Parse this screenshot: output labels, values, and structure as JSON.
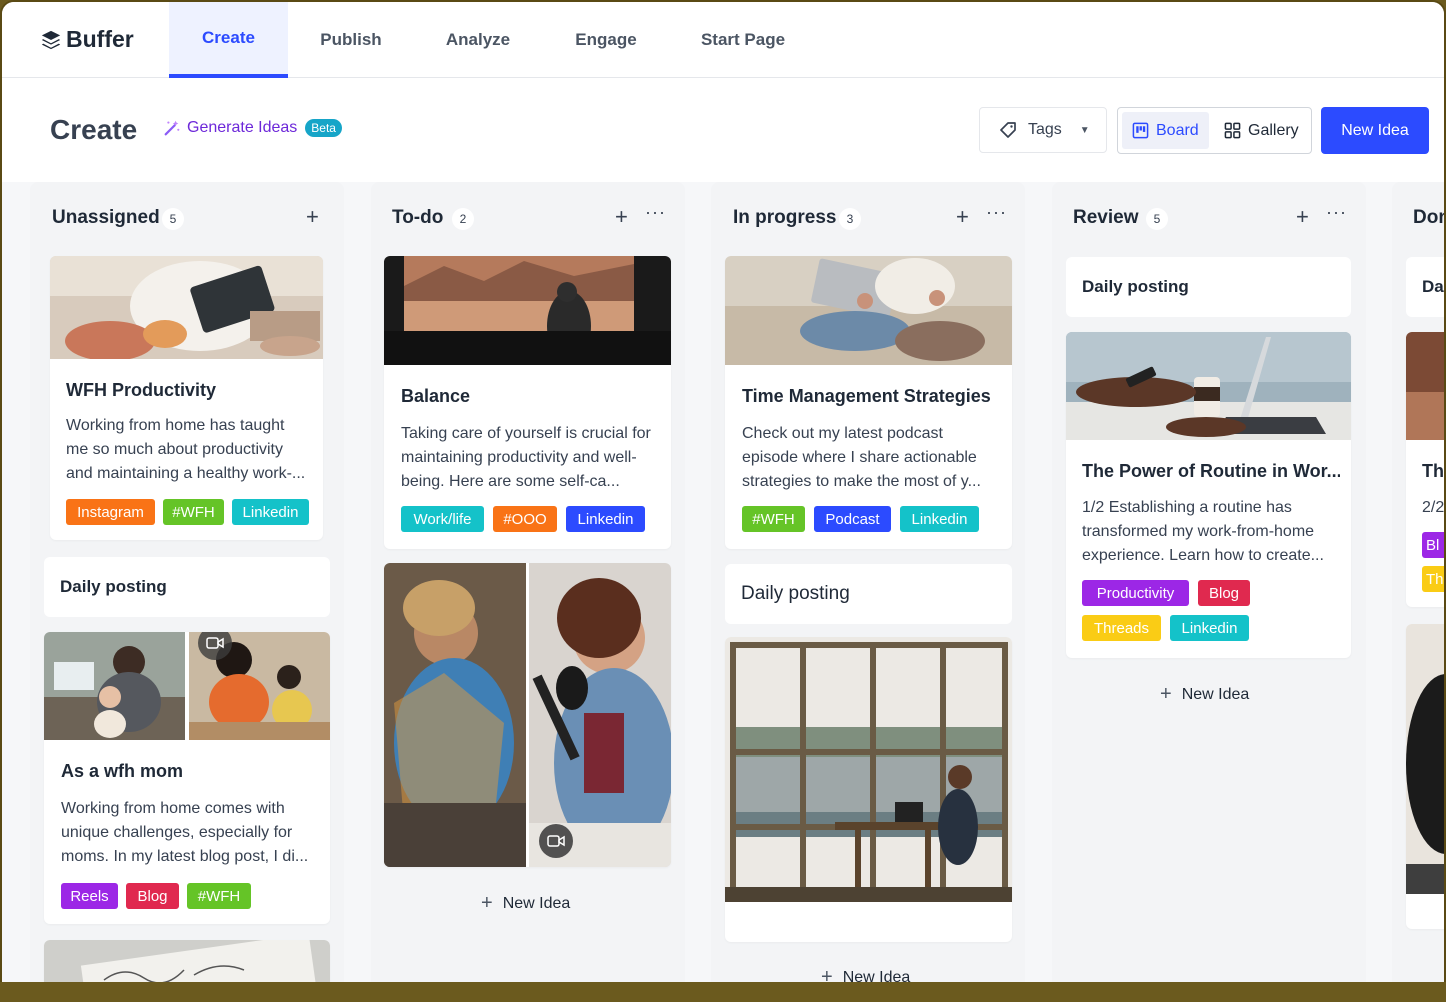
{
  "brand": {
    "name": "Buffer"
  },
  "nav": {
    "tabs": [
      {
        "label": "Create",
        "active": true
      },
      {
        "label": "Publish"
      },
      {
        "label": "Analyze"
      },
      {
        "label": "Engage"
      },
      {
        "label": "Start Page"
      }
    ]
  },
  "header": {
    "title": "Create",
    "generate_ideas": "Generate Ideas",
    "beta": "Beta",
    "tags_label": "Tags",
    "view_board": "Board",
    "view_gallery": "Gallery",
    "new_idea": "New Idea"
  },
  "colors": {
    "accent": "#2c4bff",
    "tag_orange": "#f97316",
    "tag_green": "#65c427",
    "tag_teal": "#14c2c9",
    "tag_blue": "#2c4bff",
    "tag_purple": "#9c27e6",
    "tag_red": "#e0294f",
    "tag_yellow": "#facc15"
  },
  "columns": [
    {
      "title": "Unassigned",
      "count": "5",
      "cards": [
        {
          "title": "WFH Productivity",
          "text": "Working from home has taught me so much about productivity and maintaining a healthy work-...",
          "tags": [
            "Instagram",
            "#WFH",
            "Linkedin"
          ]
        },
        {
          "title": "Daily posting"
        },
        {
          "title": "As a wfh mom",
          "text": "Working from home comes with unique challenges, especially for moms. In my latest blog post, I di...",
          "tags": [
            "Reels",
            "Blog",
            "#WFH"
          ]
        }
      ]
    },
    {
      "title": "To-do",
      "count": "2",
      "cards": [
        {
          "title": "Balance",
          "text": "Taking care of yourself is crucial for maintaining productivity and well-being. Here are some self-ca...",
          "tags": [
            "Work/life",
            "#OOO",
            "Linkedin"
          ]
        }
      ],
      "new_idea": "New Idea"
    },
    {
      "title": "In progress",
      "count": "3",
      "cards": [
        {
          "title": "Time Management Strategies",
          "text": "Check out my latest podcast episode where I share actionable strategies to make the most of y...",
          "tags": [
            "#WFH",
            "Podcast",
            "Linkedin"
          ]
        },
        {
          "title": "Daily posting"
        }
      ],
      "new_idea": "New Idea"
    },
    {
      "title": "Review",
      "count": "5",
      "cards": [
        {
          "title": "Daily posting"
        },
        {
          "title": "The Power of Routine in Wor...",
          "text": "1/2 Establishing a routine has transformed my work-from-home experience. Learn how to create...",
          "tags": [
            "Productivity",
            "Blog",
            "Threads",
            "Linkedin"
          ]
        }
      ],
      "new_idea": "New Idea"
    },
    {
      "title": "Don",
      "cards": [
        {
          "title": "Dai"
        },
        {
          "title": "The",
          "text": "2/2"
        }
      ],
      "tags": [
        "Bl",
        "Th"
      ]
    }
  ]
}
